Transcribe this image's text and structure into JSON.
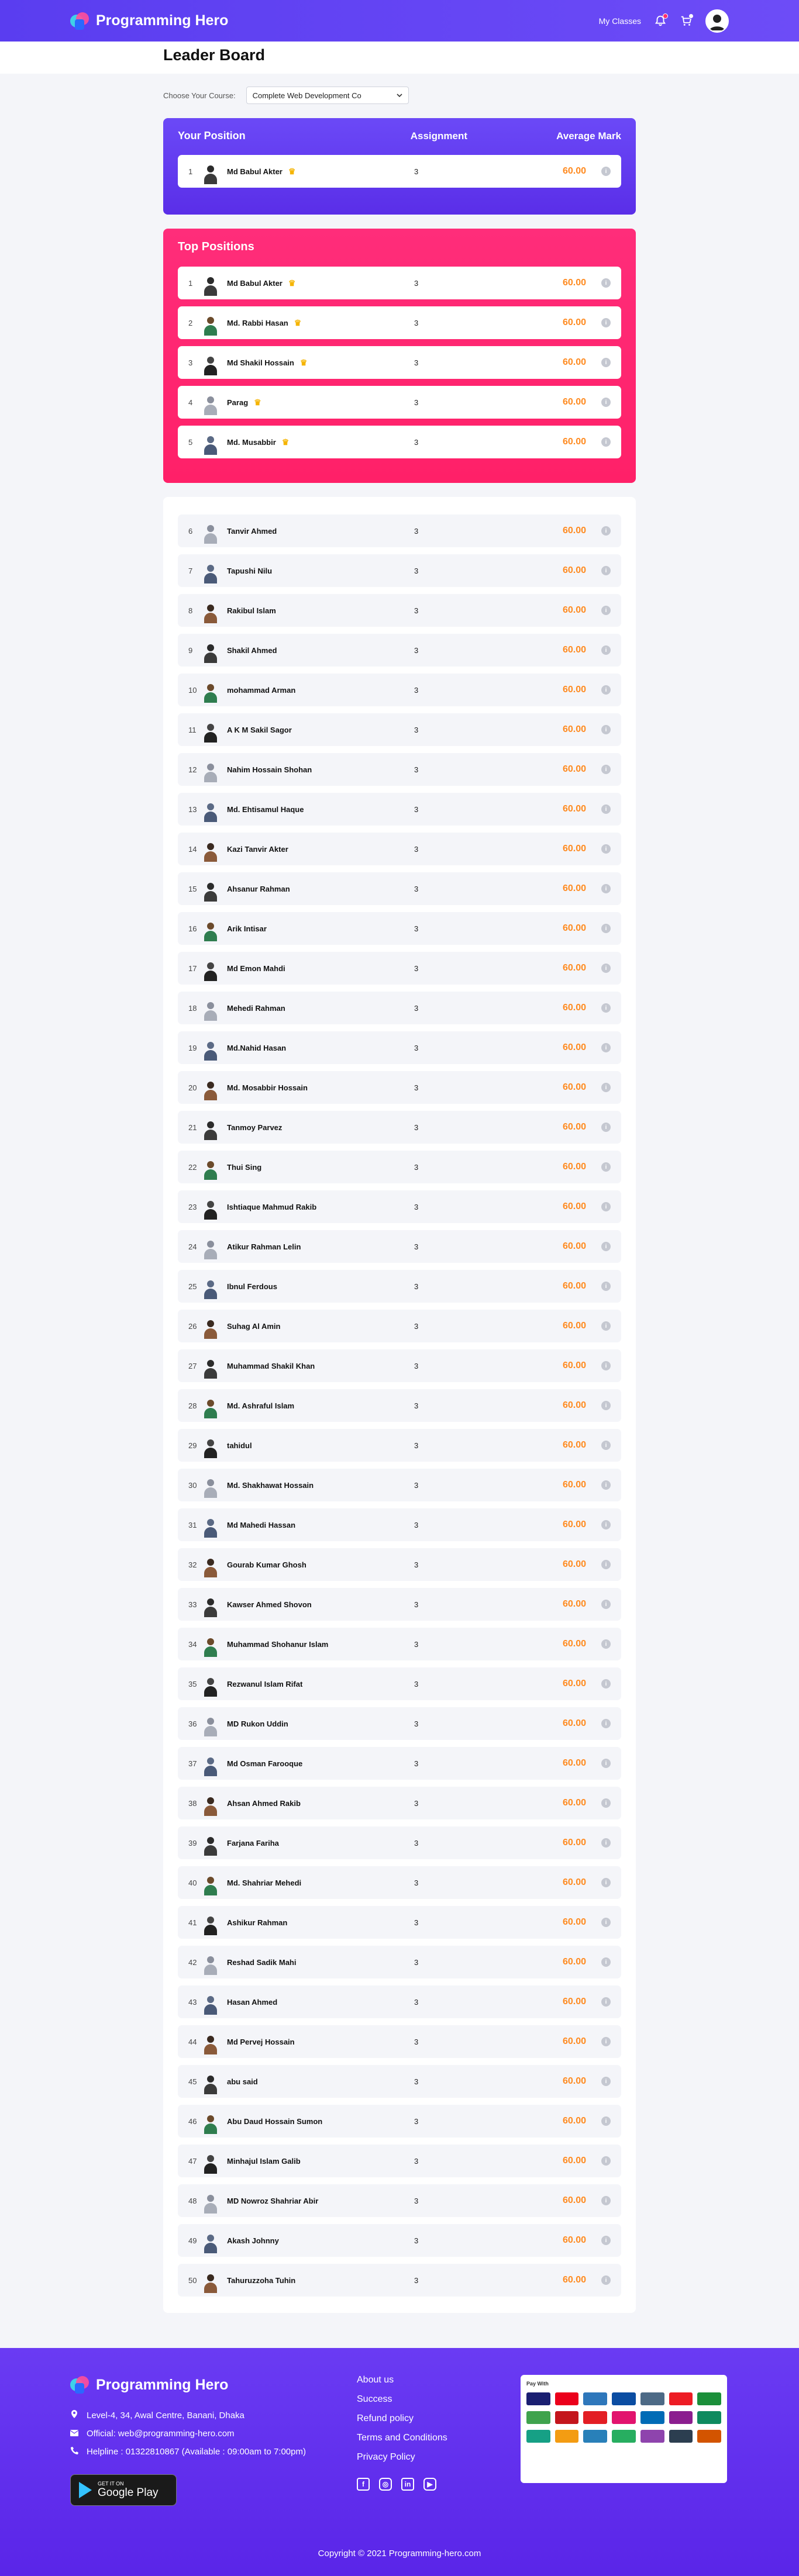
{
  "brand": {
    "name": "Programming Hero"
  },
  "nav": {
    "my_classes": "My Classes"
  },
  "page": {
    "title": "Leader Board"
  },
  "course": {
    "label": "Choose Your Course:",
    "selected": "Complete Web Development Co"
  },
  "your_position": {
    "title": "Your Position",
    "col_assignment": "Assignment",
    "col_average": "Average Mark",
    "row": {
      "rank": "1",
      "name": "Md Babul Akter",
      "assignment": "3",
      "mark": "60.00"
    }
  },
  "top_positions": {
    "title": "Top Positions",
    "rows": [
      {
        "rank": "1",
        "name": "Md Babul Akter",
        "assignment": "3",
        "mark": "60.00"
      },
      {
        "rank": "2",
        "name": "Md. Rabbi Hasan",
        "assignment": "3",
        "mark": "60.00"
      },
      {
        "rank": "3",
        "name": "Md Shakil Hossain",
        "assignment": "3",
        "mark": "60.00"
      },
      {
        "rank": "4",
        "name": "Parag",
        "assignment": "3",
        "mark": "60.00"
      },
      {
        "rank": "5",
        "name": "Md. Musabbir",
        "assignment": "3",
        "mark": "60.00"
      }
    ]
  },
  "others": [
    {
      "rank": "6",
      "name": "Tanvir Ahmed",
      "assignment": "3",
      "mark": "60.00"
    },
    {
      "rank": "7",
      "name": "Tapushi Nilu",
      "assignment": "3",
      "mark": "60.00"
    },
    {
      "rank": "8",
      "name": "Rakibul Islam",
      "assignment": "3",
      "mark": "60.00"
    },
    {
      "rank": "9",
      "name": "Shakil Ahmed",
      "assignment": "3",
      "mark": "60.00"
    },
    {
      "rank": "10",
      "name": "mohammad Arman",
      "assignment": "3",
      "mark": "60.00"
    },
    {
      "rank": "11",
      "name": "A K M Sakil Sagor",
      "assignment": "3",
      "mark": "60.00"
    },
    {
      "rank": "12",
      "name": "Nahim Hossain Shohan",
      "assignment": "3",
      "mark": "60.00"
    },
    {
      "rank": "13",
      "name": "Md. Ehtisamul Haque",
      "assignment": "3",
      "mark": "60.00"
    },
    {
      "rank": "14",
      "name": "Kazi Tanvir Akter",
      "assignment": "3",
      "mark": "60.00"
    },
    {
      "rank": "15",
      "name": "Ahsanur Rahman",
      "assignment": "3",
      "mark": "60.00"
    },
    {
      "rank": "16",
      "name": "Arik Intisar",
      "assignment": "3",
      "mark": "60.00"
    },
    {
      "rank": "17",
      "name": "Md Emon Mahdi",
      "assignment": "3",
      "mark": "60.00"
    },
    {
      "rank": "18",
      "name": "Mehedi Rahman",
      "assignment": "3",
      "mark": "60.00"
    },
    {
      "rank": "19",
      "name": "Md.Nahid Hasan",
      "assignment": "3",
      "mark": "60.00"
    },
    {
      "rank": "20",
      "name": "Md. Mosabbir Hossain",
      "assignment": "3",
      "mark": "60.00"
    },
    {
      "rank": "21",
      "name": "Tanmoy Parvez",
      "assignment": "3",
      "mark": "60.00"
    },
    {
      "rank": "22",
      "name": "Thui Sing",
      "assignment": "3",
      "mark": "60.00"
    },
    {
      "rank": "23",
      "name": "Ishtiaque Mahmud Rakib",
      "assignment": "3",
      "mark": "60.00"
    },
    {
      "rank": "24",
      "name": "Atikur Rahman Lelin",
      "assignment": "3",
      "mark": "60.00"
    },
    {
      "rank": "25",
      "name": "Ibnul Ferdous",
      "assignment": "3",
      "mark": "60.00"
    },
    {
      "rank": "26",
      "name": "Suhag Al Amin",
      "assignment": "3",
      "mark": "60.00"
    },
    {
      "rank": "27",
      "name": "Muhammad Shakil Khan",
      "assignment": "3",
      "mark": "60.00"
    },
    {
      "rank": "28",
      "name": "Md. Ashraful Islam",
      "assignment": "3",
      "mark": "60.00"
    },
    {
      "rank": "29",
      "name": "tahidul",
      "assignment": "3",
      "mark": "60.00"
    },
    {
      "rank": "30",
      "name": "Md. Shakhawat Hossain",
      "assignment": "3",
      "mark": "60.00"
    },
    {
      "rank": "31",
      "name": "Md Mahedi Hassan",
      "assignment": "3",
      "mark": "60.00"
    },
    {
      "rank": "32",
      "name": "Gourab Kumar Ghosh",
      "assignment": "3",
      "mark": "60.00"
    },
    {
      "rank": "33",
      "name": "Kawser Ahmed Shovon",
      "assignment": "3",
      "mark": "60.00"
    },
    {
      "rank": "34",
      "name": "Muhammad Shohanur Islam",
      "assignment": "3",
      "mark": "60.00"
    },
    {
      "rank": "35",
      "name": "Rezwanul Islam Rifat",
      "assignment": "3",
      "mark": "60.00"
    },
    {
      "rank": "36",
      "name": "MD Rukon Uddin",
      "assignment": "3",
      "mark": "60.00"
    },
    {
      "rank": "37",
      "name": "Md Osman Farooque",
      "assignment": "3",
      "mark": "60.00"
    },
    {
      "rank": "38",
      "name": "Ahsan Ahmed Rakib",
      "assignment": "3",
      "mark": "60.00"
    },
    {
      "rank": "39",
      "name": "Farjana Fariha",
      "assignment": "3",
      "mark": "60.00"
    },
    {
      "rank": "40",
      "name": "Md. Shahriar Mehedi",
      "assignment": "3",
      "mark": "60.00"
    },
    {
      "rank": "41",
      "name": "Ashikur Rahman",
      "assignment": "3",
      "mark": "60.00"
    },
    {
      "rank": "42",
      "name": "Reshad Sadik Mahi",
      "assignment": "3",
      "mark": "60.00"
    },
    {
      "rank": "43",
      "name": "Hasan Ahmed",
      "assignment": "3",
      "mark": "60.00"
    },
    {
      "rank": "44",
      "name": "Md Pervej Hossain",
      "assignment": "3",
      "mark": "60.00"
    },
    {
      "rank": "45",
      "name": "abu said",
      "assignment": "3",
      "mark": "60.00"
    },
    {
      "rank": "46",
      "name": "Abu Daud Hossain Sumon",
      "assignment": "3",
      "mark": "60.00"
    },
    {
      "rank": "47",
      "name": "Minhajul Islam Galib",
      "assignment": "3",
      "mark": "60.00"
    },
    {
      "rank": "48",
      "name": "MD Nowroz Shahriar Abir",
      "assignment": "3",
      "mark": "60.00"
    },
    {
      "rank": "49",
      "name": "Akash Johnny",
      "assignment": "3",
      "mark": "60.00"
    },
    {
      "rank": "50",
      "name": "Tahuruzzoha Tuhin",
      "assignment": "3",
      "mark": "60.00"
    }
  ],
  "footer": {
    "brand": "Programming Hero",
    "address": "Level-4, 34, Awal Centre, Banani, Dhaka",
    "email": "Official: web@programming-hero.com",
    "helpline": "Helpline : 01322810867 (Available : 09:00am to 7:00pm)",
    "gplay_small": "GET IT ON",
    "gplay_big": "Google Play",
    "links": [
      "About us",
      "Success",
      "Refund policy",
      "Terms and Conditions",
      "Privacy Policy"
    ],
    "pay_title": "Pay With",
    "copyright": "Copyright © 2021 Programming-hero.com"
  },
  "colors": {
    "primary": "#6b49f7",
    "pink": "#ff2d7a",
    "mark": "#ff8a1f"
  }
}
